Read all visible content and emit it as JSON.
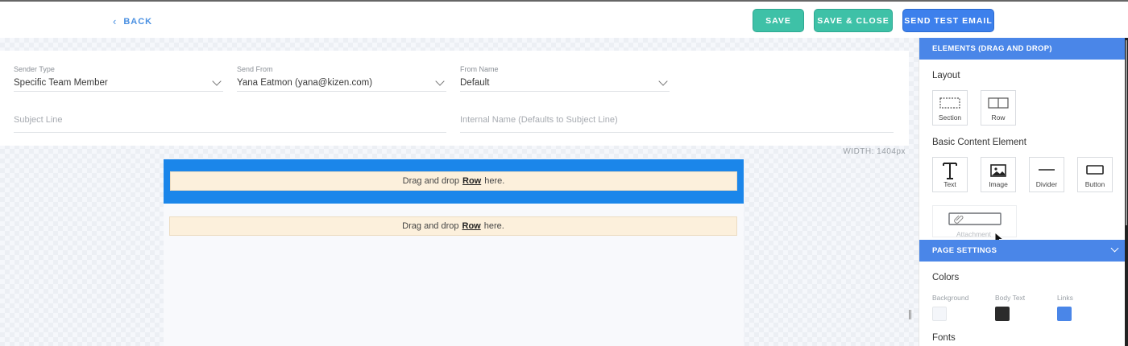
{
  "topbar": {
    "back_label": "BACK",
    "save_label": "SAVE",
    "save_close_label": "SAVE & CLOSE",
    "send_test_label": "SEND TEST EMAIL"
  },
  "form": {
    "sender_type": {
      "label": "Sender Type",
      "value": "Specific Team Member"
    },
    "send_from": {
      "label": "Send From",
      "value": "Yana Eatmon (yana@kizen.com)"
    },
    "from_name": {
      "label": "From Name",
      "value": "Default"
    },
    "subject_line": {
      "placeholder": "Subject Line"
    },
    "internal_name": {
      "placeholder": "Internal Name (Defaults to Subject Line)"
    }
  },
  "canvas": {
    "width_label": "WIDTH: 1404px",
    "drop_prefix": "Drag and drop",
    "drop_keyword": "Row",
    "drop_suffix": "here."
  },
  "panel": {
    "elements_header": "ELEMENTS (DRAG AND DROP)",
    "layout_title": "Layout",
    "layout_tiles": [
      {
        "label": "Section",
        "icon": "section-icon"
      },
      {
        "label": "Row",
        "icon": "row-icon"
      }
    ],
    "basic_title": "Basic Content Element",
    "basic_tiles": [
      {
        "label": "Text",
        "icon": "text-icon"
      },
      {
        "label": "Image",
        "icon": "image-icon"
      },
      {
        "label": "Divider",
        "icon": "divider-icon"
      },
      {
        "label": "Button",
        "icon": "button-icon"
      }
    ],
    "attachment_label": "Attachment",
    "page_settings_header": "PAGE SETTINGS",
    "colors_title": "Colors",
    "colors": [
      {
        "label": "Background",
        "color": "#f4f6fa"
      },
      {
        "label": "Body Text",
        "color": "#2b2b2b"
      },
      {
        "label": "Links",
        "color": "#4a86e8"
      }
    ],
    "fonts_title": "Fonts"
  },
  "theme": {
    "accent": "#4a86e8",
    "teal": "#3ec1a7",
    "drop_selected": "#1b86ea",
    "drop_fill": "#fcf0dc"
  }
}
